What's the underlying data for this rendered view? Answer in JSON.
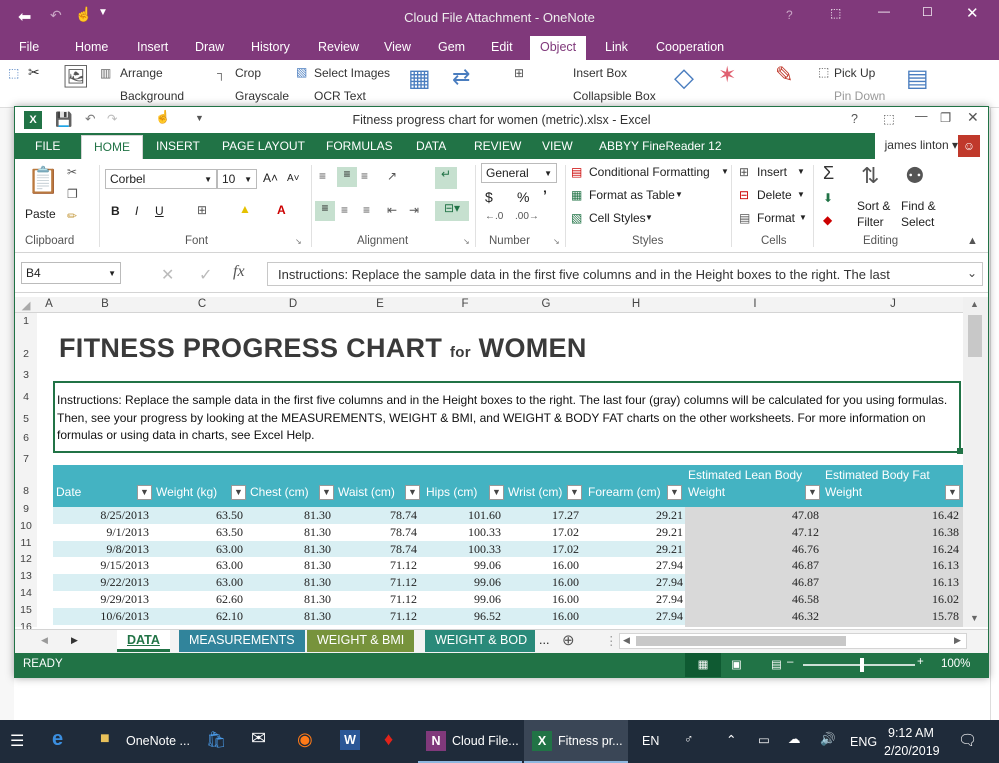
{
  "onenote": {
    "title": "Cloud File Attachment - OneNote",
    "qmark": "?",
    "tabs": [
      "File",
      "Home",
      "Insert",
      "Draw",
      "History",
      "Review",
      "View",
      "Gem",
      "Edit",
      "Object",
      "Link",
      "Cooperation"
    ],
    "ribbon": {
      "arrange": "Arrange",
      "background": "Background",
      "crop": "Crop",
      "grayscale": "Grayscale",
      "select_images": "Select Images",
      "ocr_text": "OCR Text",
      "insert_box": "Insert Box",
      "collapsible_box": "Collapsible Box",
      "pick_up": "Pick Up",
      "pin_down": "Pin Down"
    }
  },
  "excel": {
    "title": "Fitness progress chart for women (metric).xlsx - Excel",
    "help": "?",
    "tabs": [
      "FILE",
      "HOME",
      "INSERT",
      "PAGE LAYOUT",
      "FORMULAS",
      "DATA",
      "REVIEW",
      "VIEW",
      "ABBYY FineReader 12"
    ],
    "user": "james linton",
    "ribbon": {
      "paste": "Paste",
      "clipboard": "Clipboard",
      "font_name": "Corbel",
      "font_size": "10",
      "font": "Font",
      "bold": "B",
      "italic": "I",
      "underline": "U",
      "alignment": "Alignment",
      "number_format": "General",
      "number": "Number",
      "currency": "$",
      "percent": "%",
      "comma": "’",
      "cond_format": "Conditional Formatting",
      "format_table": "Format as Table",
      "cell_styles": "Cell Styles",
      "styles": "Styles",
      "insert": "Insert",
      "delete": "Delete",
      "format": "Format",
      "cells": "Cells",
      "sum": "Σ",
      "sort_filter": "Sort &",
      "sort_filter2": "Filter",
      "find_select": "Find &",
      "find_select2": "Select",
      "editing": "Editing"
    },
    "name_box": "B4",
    "fx": "fx",
    "formula": "Instructions: Replace the sample data in the first five columns and in the Height boxes to the right. The last",
    "col_headers": [
      "A",
      "B",
      "C",
      "D",
      "E",
      "F",
      "G",
      "H",
      "I",
      "J"
    ],
    "row_headers": [
      "1",
      "2",
      "3",
      "4",
      "5",
      "6",
      "7",
      "8",
      "9",
      "10",
      "11",
      "12",
      "13",
      "14",
      "15",
      "16"
    ],
    "sheet_title": "FITNESS PROGRESS CHART",
    "sheet_for": "for",
    "sheet_women": "WOMEN",
    "instructions": "Instructions: Replace the sample data in the first five columns and in the Height boxes to the right. The last four (gray) columns will be calculated for you using formulas. Then, see your progress by looking at the MEASUREMENTS, WEIGHT & BMI, and WEIGHT & BODY FAT charts on the other worksheets. For more information on formulas or using data in charts, see Excel Help.",
    "headers": [
      "Date",
      "Weight (kg)",
      "Chest (cm)",
      "Waist (cm)",
      "Hips (cm)",
      "Wrist (cm)",
      "Forearm (cm)",
      "Estimated Lean Body",
      "Weight",
      "Estimated Body Fat",
      "Weight"
    ],
    "rows": [
      [
        "8/25/2013",
        "63.50",
        "81.30",
        "78.74",
        "101.60",
        "17.27",
        "29.21",
        "47.08",
        "16.42"
      ],
      [
        "9/1/2013",
        "63.50",
        "81.30",
        "78.74",
        "100.33",
        "17.02",
        "29.21",
        "47.12",
        "16.38"
      ],
      [
        "9/8/2013",
        "63.00",
        "81.30",
        "78.74",
        "100.33",
        "17.02",
        "29.21",
        "46.76",
        "16.24"
      ],
      [
        "9/15/2013",
        "63.00",
        "81.30",
        "71.12",
        "99.06",
        "16.00",
        "27.94",
        "46.87",
        "16.13"
      ],
      [
        "9/22/2013",
        "63.00",
        "81.30",
        "71.12",
        "99.06",
        "16.00",
        "27.94",
        "46.87",
        "16.13"
      ],
      [
        "9/29/2013",
        "62.60",
        "81.30",
        "71.12",
        "99.06",
        "16.00",
        "27.94",
        "46.58",
        "16.02"
      ],
      [
        "10/6/2013",
        "62.10",
        "81.30",
        "71.12",
        "96.52",
        "16.00",
        "27.94",
        "46.32",
        "15.78"
      ]
    ],
    "sheets": [
      "DATA",
      "MEASUREMENTS",
      "WEIGHT & BMI",
      "WEIGHT & BOD",
      "..."
    ],
    "status": "READY",
    "zoom": "100%"
  },
  "taskbar": {
    "apps": [
      "OneNote ...",
      "Cloud File...",
      "Fitness pr..."
    ],
    "lang": "EN",
    "lang2": "ENG",
    "time": "9:12 AM",
    "date": "2/20/2019"
  },
  "colors": {
    "onenote": "#80397b",
    "excel": "#217346",
    "table_header": "#44b3c2",
    "row_alt": "#d9eff3"
  }
}
